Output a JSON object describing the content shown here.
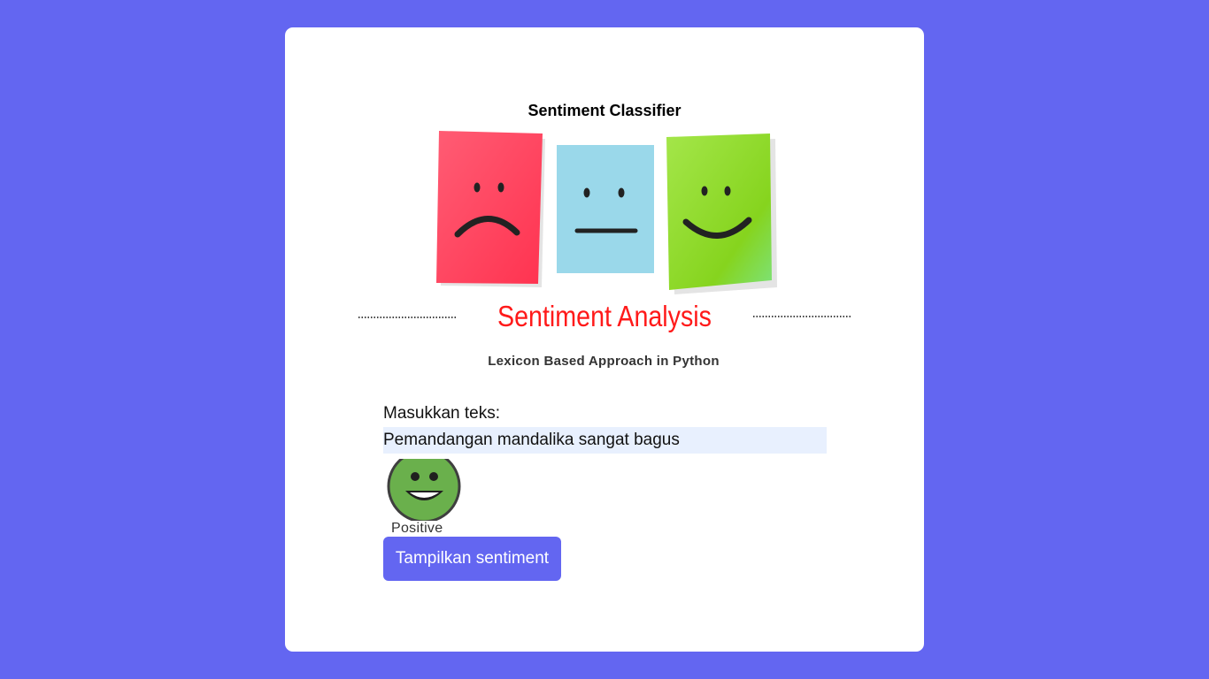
{
  "page": {
    "title": "Sentiment Classifier",
    "background_color": "#6366f1",
    "card_color": "#ffffff"
  },
  "banner": {
    "heading": "Sentiment Analysis",
    "subheading": "Lexicon Based Approach in Python",
    "heading_color": "#ff1a1a",
    "notes": [
      {
        "mood": "sad",
        "icon": "sad-face-icon",
        "color": "#ff4d6a"
      },
      {
        "mood": "neutral",
        "icon": "neutral-face-icon",
        "color": "#9ad8ea"
      },
      {
        "mood": "happy",
        "icon": "happy-face-icon",
        "color": "#8ed936"
      }
    ]
  },
  "form": {
    "label": "Masukkan teks:",
    "input_value": "Pemandangan mandalika sangat bagus",
    "submit_label": "Tampilkan sentiment"
  },
  "result": {
    "icon": "smiley-positive-icon",
    "label": "Positive",
    "color": "#6ab04c"
  }
}
